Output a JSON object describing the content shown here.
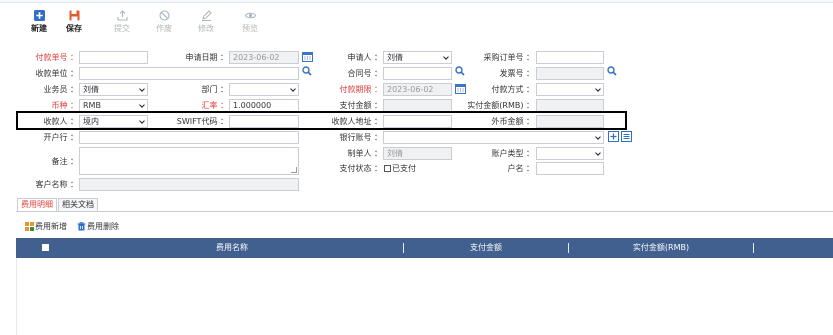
{
  "toolbar": {
    "new": "新建",
    "save": "保存",
    "submit": "提交",
    "void": "作废",
    "edit": "修改",
    "preview": "预览"
  },
  "form": {
    "payment_no": {
      "label": "付款单号 ：",
      "value": ""
    },
    "apply_date": {
      "label": "申请日期 ：",
      "value": "2023-06-02"
    },
    "applicant": {
      "label": "申请人 ：",
      "value": "刘倩"
    },
    "po_no": {
      "label": "采购订单号 ：",
      "value": ""
    },
    "payee_unit": {
      "label": "收款单位 ：",
      "value": ""
    },
    "contract_no": {
      "label": "合同号 ：",
      "value": ""
    },
    "invoice_no": {
      "label": "发票号 ：",
      "value": ""
    },
    "salesman": {
      "label": "业务员 ：",
      "value": "刘倩"
    },
    "department": {
      "label": "部门 ：",
      "value": ""
    },
    "pay_due": {
      "label": "付款期限 ：",
      "value": "2023-06-02"
    },
    "pay_method": {
      "label": "付款方式 ：",
      "value": ""
    },
    "currency": {
      "label": "币种 ：",
      "value": "RMB"
    },
    "exchange_rate": {
      "label": "汇率 ：",
      "value": "1.000000"
    },
    "pay_amount": {
      "label": "支付金额 ：",
      "value": ""
    },
    "actual_amount_rmb": {
      "label": "实付金额(RMB) ：",
      "value": ""
    },
    "payee_type": {
      "label": "收款人 ：",
      "value": "境内"
    },
    "swift": {
      "label": "SWIFT代码 ：",
      "value": ""
    },
    "payee_address": {
      "label": "收款人地址 ：",
      "value": ""
    },
    "foreign_amount": {
      "label": "外币金额 ：",
      "value": ""
    },
    "bank": {
      "label": "开户行 ：",
      "value": ""
    },
    "bank_account": {
      "label": "银行账号 ：",
      "value": ""
    },
    "remark": {
      "label": "备注 ：",
      "value": ""
    },
    "creator": {
      "label": "制单人 ：",
      "value": "刘倩"
    },
    "account_type": {
      "label": "账户类型 ：",
      "value": ""
    },
    "pay_status": {
      "label": "支付状态 ：",
      "checkbox_label": "已支付"
    },
    "account_name": {
      "label": "户名 ：",
      "value": ""
    },
    "customer_name": {
      "label": "客户名称 ：",
      "value": ""
    }
  },
  "tabs": [
    "费用明细",
    "相关文档"
  ],
  "actions": {
    "add": "费用新增",
    "delete": "费用删除"
  },
  "grid": {
    "columns": [
      "费用名称",
      "支付金额",
      "实付金额(RMB)"
    ]
  },
  "colors": {
    "required_label": "#e23b3b",
    "grid_header": "#415f8f",
    "primary_icon": "#2f6fc8",
    "save_icon": "#e05a2a"
  }
}
